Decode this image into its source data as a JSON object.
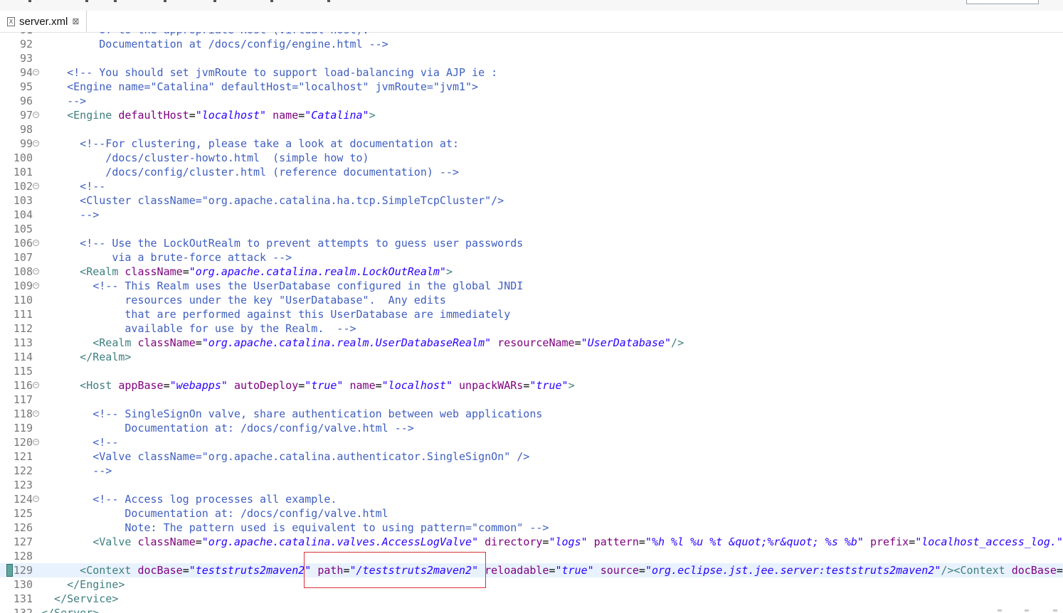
{
  "tab": {
    "title": "server.xml",
    "close_symbol": "⊠",
    "icon": "xml-file-icon"
  },
  "colors": {
    "comment": "#3f5fbf",
    "tag": "#3f7f7f",
    "attribute": "#7f007f",
    "value": "#2a00ff",
    "line_number": "#787878",
    "current_line_bg": "#e8f2fe",
    "highlight_box": "#d9303a"
  },
  "current_line": 129,
  "lines": [
    {
      "num": "91",
      "fold": false,
      "code": [
        {
          "t": "cm",
          "s": "         Of to the appropriate Host (virtual host)."
        }
      ]
    },
    {
      "num": "92",
      "fold": false,
      "code": [
        {
          "t": "cm",
          "s": "         Documentation at /docs/config/engine.html -->"
        }
      ]
    },
    {
      "num": "93",
      "fold": false,
      "code": []
    },
    {
      "num": "94",
      "fold": true,
      "code": [
        {
          "t": "cm",
          "s": "    <!-- You should set jvmRoute to support load-balancing via AJP ie :"
        }
      ]
    },
    {
      "num": "95",
      "fold": false,
      "code": [
        {
          "t": "cm",
          "s": "    <Engine name=\"Catalina\" defaultHost=\"localhost\" jvmRoute=\"jvm1\">"
        }
      ]
    },
    {
      "num": "96",
      "fold": false,
      "code": [
        {
          "t": "cm",
          "s": "    -->"
        }
      ]
    },
    {
      "num": "97",
      "fold": true,
      "code": [
        {
          "t": "tag",
          "s": "    <Engine "
        },
        {
          "t": "attr",
          "s": "defaultHost"
        },
        {
          "t": "plain",
          "s": "="
        },
        {
          "t": "val",
          "s": "\"localhost\""
        },
        {
          "t": "plain",
          "s": " "
        },
        {
          "t": "attr",
          "s": "name"
        },
        {
          "t": "plain",
          "s": "="
        },
        {
          "t": "val",
          "s": "\"Catalina\""
        },
        {
          "t": "tag",
          "s": ">"
        }
      ]
    },
    {
      "num": "98",
      "fold": false,
      "code": []
    },
    {
      "num": "99",
      "fold": true,
      "code": [
        {
          "t": "cm",
          "s": "      <!--For clustering, please take a look at documentation at:"
        }
      ]
    },
    {
      "num": "100",
      "fold": false,
      "code": [
        {
          "t": "cm",
          "s": "          /docs/cluster-howto.html  (simple how to)"
        }
      ]
    },
    {
      "num": "101",
      "fold": false,
      "code": [
        {
          "t": "cm",
          "s": "          /docs/config/cluster.html (reference documentation) -->"
        }
      ]
    },
    {
      "num": "102",
      "fold": true,
      "code": [
        {
          "t": "cm",
          "s": "      <!--"
        }
      ]
    },
    {
      "num": "103",
      "fold": false,
      "code": [
        {
          "t": "cm",
          "s": "      <Cluster className=\"org.apache.catalina.ha.tcp.SimpleTcpCluster\"/>"
        }
      ]
    },
    {
      "num": "104",
      "fold": false,
      "code": [
        {
          "t": "cm",
          "s": "      -->"
        }
      ]
    },
    {
      "num": "105",
      "fold": false,
      "code": []
    },
    {
      "num": "106",
      "fold": true,
      "code": [
        {
          "t": "cm",
          "s": "      <!-- Use the LockOutRealm to prevent attempts to guess user passwords"
        }
      ]
    },
    {
      "num": "107",
      "fold": false,
      "code": [
        {
          "t": "cm",
          "s": "           via a brute-force attack -->"
        }
      ]
    },
    {
      "num": "108",
      "fold": true,
      "code": [
        {
          "t": "tag",
          "s": "      <Realm "
        },
        {
          "t": "attr",
          "s": "className"
        },
        {
          "t": "plain",
          "s": "="
        },
        {
          "t": "val",
          "s": "\"org.apache.catalina.realm.LockOutRealm\""
        },
        {
          "t": "tag",
          "s": ">"
        }
      ]
    },
    {
      "num": "109",
      "fold": true,
      "code": [
        {
          "t": "cm",
          "s": "        <!-- This Realm uses the UserDatabase configured in the global JNDI"
        }
      ]
    },
    {
      "num": "110",
      "fold": false,
      "code": [
        {
          "t": "cm",
          "s": "             resources under the key \"UserDatabase\".  Any edits"
        }
      ]
    },
    {
      "num": "111",
      "fold": false,
      "code": [
        {
          "t": "cm",
          "s": "             that are performed against this UserDatabase are immediately"
        }
      ]
    },
    {
      "num": "112",
      "fold": false,
      "code": [
        {
          "t": "cm",
          "s": "             available for use by the Realm.  -->"
        }
      ]
    },
    {
      "num": "113",
      "fold": false,
      "code": [
        {
          "t": "tag",
          "s": "        <Realm "
        },
        {
          "t": "attr",
          "s": "className"
        },
        {
          "t": "plain",
          "s": "="
        },
        {
          "t": "val",
          "s": "\"org.apache.catalina.realm.UserDatabaseRealm\""
        },
        {
          "t": "plain",
          "s": " "
        },
        {
          "t": "attr",
          "s": "resourceName"
        },
        {
          "t": "plain",
          "s": "="
        },
        {
          "t": "val",
          "s": "\"UserDatabase\""
        },
        {
          "t": "tag",
          "s": "/>"
        }
      ]
    },
    {
      "num": "114",
      "fold": false,
      "code": [
        {
          "t": "tag",
          "s": "      </Realm>"
        }
      ]
    },
    {
      "num": "115",
      "fold": false,
      "code": []
    },
    {
      "num": "116",
      "fold": true,
      "code": [
        {
          "t": "tag",
          "s": "      <Host "
        },
        {
          "t": "attr",
          "s": "appBase"
        },
        {
          "t": "plain",
          "s": "="
        },
        {
          "t": "val",
          "s": "\"webapps\""
        },
        {
          "t": "plain",
          "s": " "
        },
        {
          "t": "attr",
          "s": "autoDeploy"
        },
        {
          "t": "plain",
          "s": "="
        },
        {
          "t": "val",
          "s": "\"true\""
        },
        {
          "t": "plain",
          "s": " "
        },
        {
          "t": "attr",
          "s": "name"
        },
        {
          "t": "plain",
          "s": "="
        },
        {
          "t": "val",
          "s": "\"localhost\""
        },
        {
          "t": "plain",
          "s": " "
        },
        {
          "t": "attr",
          "s": "unpackWARs"
        },
        {
          "t": "plain",
          "s": "="
        },
        {
          "t": "val",
          "s": "\"true\""
        },
        {
          "t": "tag",
          "s": ">"
        }
      ]
    },
    {
      "num": "117",
      "fold": false,
      "code": []
    },
    {
      "num": "118",
      "fold": true,
      "code": [
        {
          "t": "cm",
          "s": "        <!-- SingleSignOn valve, share authentication between web applications"
        }
      ]
    },
    {
      "num": "119",
      "fold": false,
      "code": [
        {
          "t": "cm",
          "s": "             Documentation at: /docs/config/valve.html -->"
        }
      ]
    },
    {
      "num": "120",
      "fold": true,
      "code": [
        {
          "t": "cm",
          "s": "        <!--"
        }
      ]
    },
    {
      "num": "121",
      "fold": false,
      "code": [
        {
          "t": "cm",
          "s": "        <Valve className=\"org.apache.catalina.authenticator.SingleSignOn\" />"
        }
      ]
    },
    {
      "num": "122",
      "fold": false,
      "code": [
        {
          "t": "cm",
          "s": "        -->"
        }
      ]
    },
    {
      "num": "123",
      "fold": false,
      "code": []
    },
    {
      "num": "124",
      "fold": true,
      "code": [
        {
          "t": "cm",
          "s": "        <!-- Access log processes all example."
        }
      ]
    },
    {
      "num": "125",
      "fold": false,
      "code": [
        {
          "t": "cm",
          "s": "             Documentation at: /docs/config/valve.html"
        }
      ]
    },
    {
      "num": "126",
      "fold": false,
      "code": [
        {
          "t": "cm",
          "s": "             Note: The pattern used is equivalent to using pattern=\"common\" -->"
        }
      ]
    },
    {
      "num": "127",
      "fold": false,
      "code": [
        {
          "t": "tag",
          "s": "        <Valve "
        },
        {
          "t": "attr",
          "s": "className"
        },
        {
          "t": "plain",
          "s": "="
        },
        {
          "t": "val",
          "s": "\"org.apache.catalina.valves.AccessLogValve\""
        },
        {
          "t": "plain",
          "s": " "
        },
        {
          "t": "attr",
          "s": "directory"
        },
        {
          "t": "plain",
          "s": "="
        },
        {
          "t": "val",
          "s": "\"logs\""
        },
        {
          "t": "plain",
          "s": " "
        },
        {
          "t": "attr",
          "s": "pattern"
        },
        {
          "t": "plain",
          "s": "="
        },
        {
          "t": "val",
          "s": "\"%h %l %u %t &quot;%r&quot; %s %b\""
        },
        {
          "t": "plain",
          "s": " "
        },
        {
          "t": "attr",
          "s": "prefix"
        },
        {
          "t": "plain",
          "s": "="
        },
        {
          "t": "val",
          "s": "\"localhost_access_log.\""
        }
      ]
    },
    {
      "num": "128",
      "fold": false,
      "code": []
    },
    {
      "num": "129",
      "fold": false,
      "code": [
        {
          "t": "tag",
          "s": "      <Context "
        },
        {
          "t": "attr",
          "s": "docBase"
        },
        {
          "t": "plain",
          "s": "="
        },
        {
          "t": "val",
          "s": "\"teststruts2maven2\""
        },
        {
          "t": "plain",
          "s": " "
        },
        {
          "t": "attr",
          "s": "path"
        },
        {
          "t": "plain",
          "s": "="
        },
        {
          "t": "val",
          "s": "\"/teststruts2maven2\""
        },
        {
          "t": "plain",
          "s": " "
        },
        {
          "t": "attr",
          "s": "reloadable"
        },
        {
          "t": "plain",
          "s": "="
        },
        {
          "t": "val",
          "s": "\"true\""
        },
        {
          "t": "plain",
          "s": " "
        },
        {
          "t": "attr",
          "s": "source"
        },
        {
          "t": "plain",
          "s": "="
        },
        {
          "t": "val",
          "s": "\"org.eclipse.jst.jee.server:teststruts2maven2\""
        },
        {
          "t": "tag",
          "s": "/><Context "
        },
        {
          "t": "attr",
          "s": "docBase"
        },
        {
          "t": "plain",
          "s": "="
        },
        {
          "t": "val",
          "s": "\""
        }
      ]
    },
    {
      "num": "130",
      "fold": false,
      "code": [
        {
          "t": "tag",
          "s": "    </Engine>"
        }
      ]
    },
    {
      "num": "131",
      "fold": false,
      "code": [
        {
          "t": "tag",
          "s": "  </Service>"
        }
      ]
    },
    {
      "num": "132",
      "fold": false,
      "code": [
        {
          "t": "tag",
          "s": "</Server>"
        }
      ]
    }
  ]
}
